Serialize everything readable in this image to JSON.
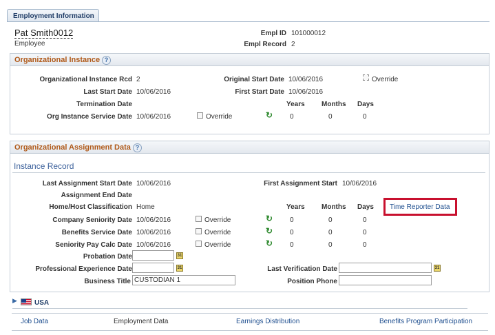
{
  "tab": {
    "label": "Employment Information"
  },
  "employee": {
    "name": "Pat Smith0012",
    "role": "Employee",
    "empl_id_label": "Empl ID",
    "empl_id": "101000012",
    "empl_record_label": "Empl Record",
    "empl_record": "2"
  },
  "org_instance": {
    "title": "Organizational Instance",
    "rcd_label": "Organizational Instance Rcd",
    "rcd": "2",
    "original_start_label": "Original Start Date",
    "original_start": "10/06/2016",
    "override_label": "Override",
    "last_start_label": "Last Start Date",
    "last_start": "10/06/2016",
    "first_start_label": "First Start Date",
    "first_start": "10/06/2016",
    "termination_label": "Termination Date",
    "years_label": "Years",
    "months_label": "Months",
    "days_label": "Days",
    "service_label": "Org Instance Service Date",
    "service_date": "10/06/2016",
    "service_override_label": "Override",
    "years": "0",
    "months": "0",
    "days": "0"
  },
  "assignment": {
    "title": "Organizational Assignment Data",
    "instance_record": "Instance Record",
    "last_assign_start_label": "Last Assignment Start Date",
    "last_assign_start": "10/06/2016",
    "first_assign_start_label": "First Assignment Start",
    "first_assign_start": "10/06/2016",
    "assign_end_label": "Assignment End Date",
    "classification_label": "Home/Host Classification",
    "classification": "Home",
    "years_label": "Years",
    "months_label": "Months",
    "days_label": "Days",
    "time_reporter_link": "Time Reporter Data",
    "rows": [
      {
        "label": "Company Seniority Date",
        "date": "10/06/2016",
        "override": "Override",
        "years": "0",
        "months": "0",
        "days": "0"
      },
      {
        "label": "Benefits Service Date",
        "date": "10/06/2016",
        "override": "Override",
        "years": "0",
        "months": "0",
        "days": "0"
      },
      {
        "label": "Seniority Pay Calc Date",
        "date": "10/06/2016",
        "override": "Override",
        "years": "0",
        "months": "0",
        "days": "0"
      }
    ],
    "probation_label": "Probation Date",
    "probation": "",
    "prof_exp_label": "Professional Experience Date",
    "prof_exp": "",
    "last_verification_label": "Last Verification Date",
    "last_verification": "",
    "business_title_label": "Business Title",
    "business_title": "CUSTODIAN 1",
    "position_phone_label": "Position Phone",
    "position_phone": ""
  },
  "country": {
    "label": "USA"
  },
  "footer_links": [
    {
      "label": "Job Data"
    },
    {
      "label": "Employment Data"
    },
    {
      "label": "Earnings Distribution"
    },
    {
      "label": "Benefits Program Participation"
    }
  ],
  "colors": {
    "group_title": "#b05a1a",
    "link": "#1f4f8f",
    "highlight": "#c8102e"
  }
}
